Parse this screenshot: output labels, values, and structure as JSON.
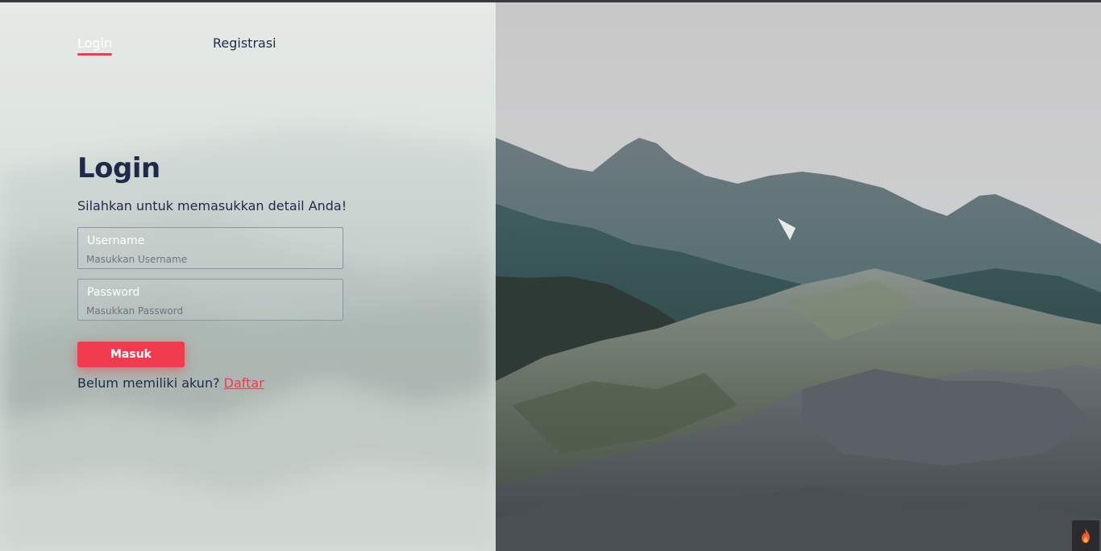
{
  "nav": {
    "tabs": [
      {
        "label": "Login",
        "active": true
      },
      {
        "label": "Registrasi",
        "active": false
      }
    ]
  },
  "form": {
    "title": "Login",
    "subtitle": "Silahkan untuk memasukkan detail Anda!",
    "username": {
      "label": "Username",
      "placeholder": "Masukkan Username",
      "value": ""
    },
    "password": {
      "label": "Password",
      "placeholder": "Masukkan Password",
      "value": ""
    },
    "submit_label": "Masuk",
    "signup_prompt": "Belum memiliki akun?",
    "signup_link": "Daftar"
  },
  "corner": {
    "icon": "flame-icon"
  },
  "colors": {
    "accent": "#ef3b4d",
    "text": "#1f2a4a",
    "field_label": "#ffffff"
  }
}
